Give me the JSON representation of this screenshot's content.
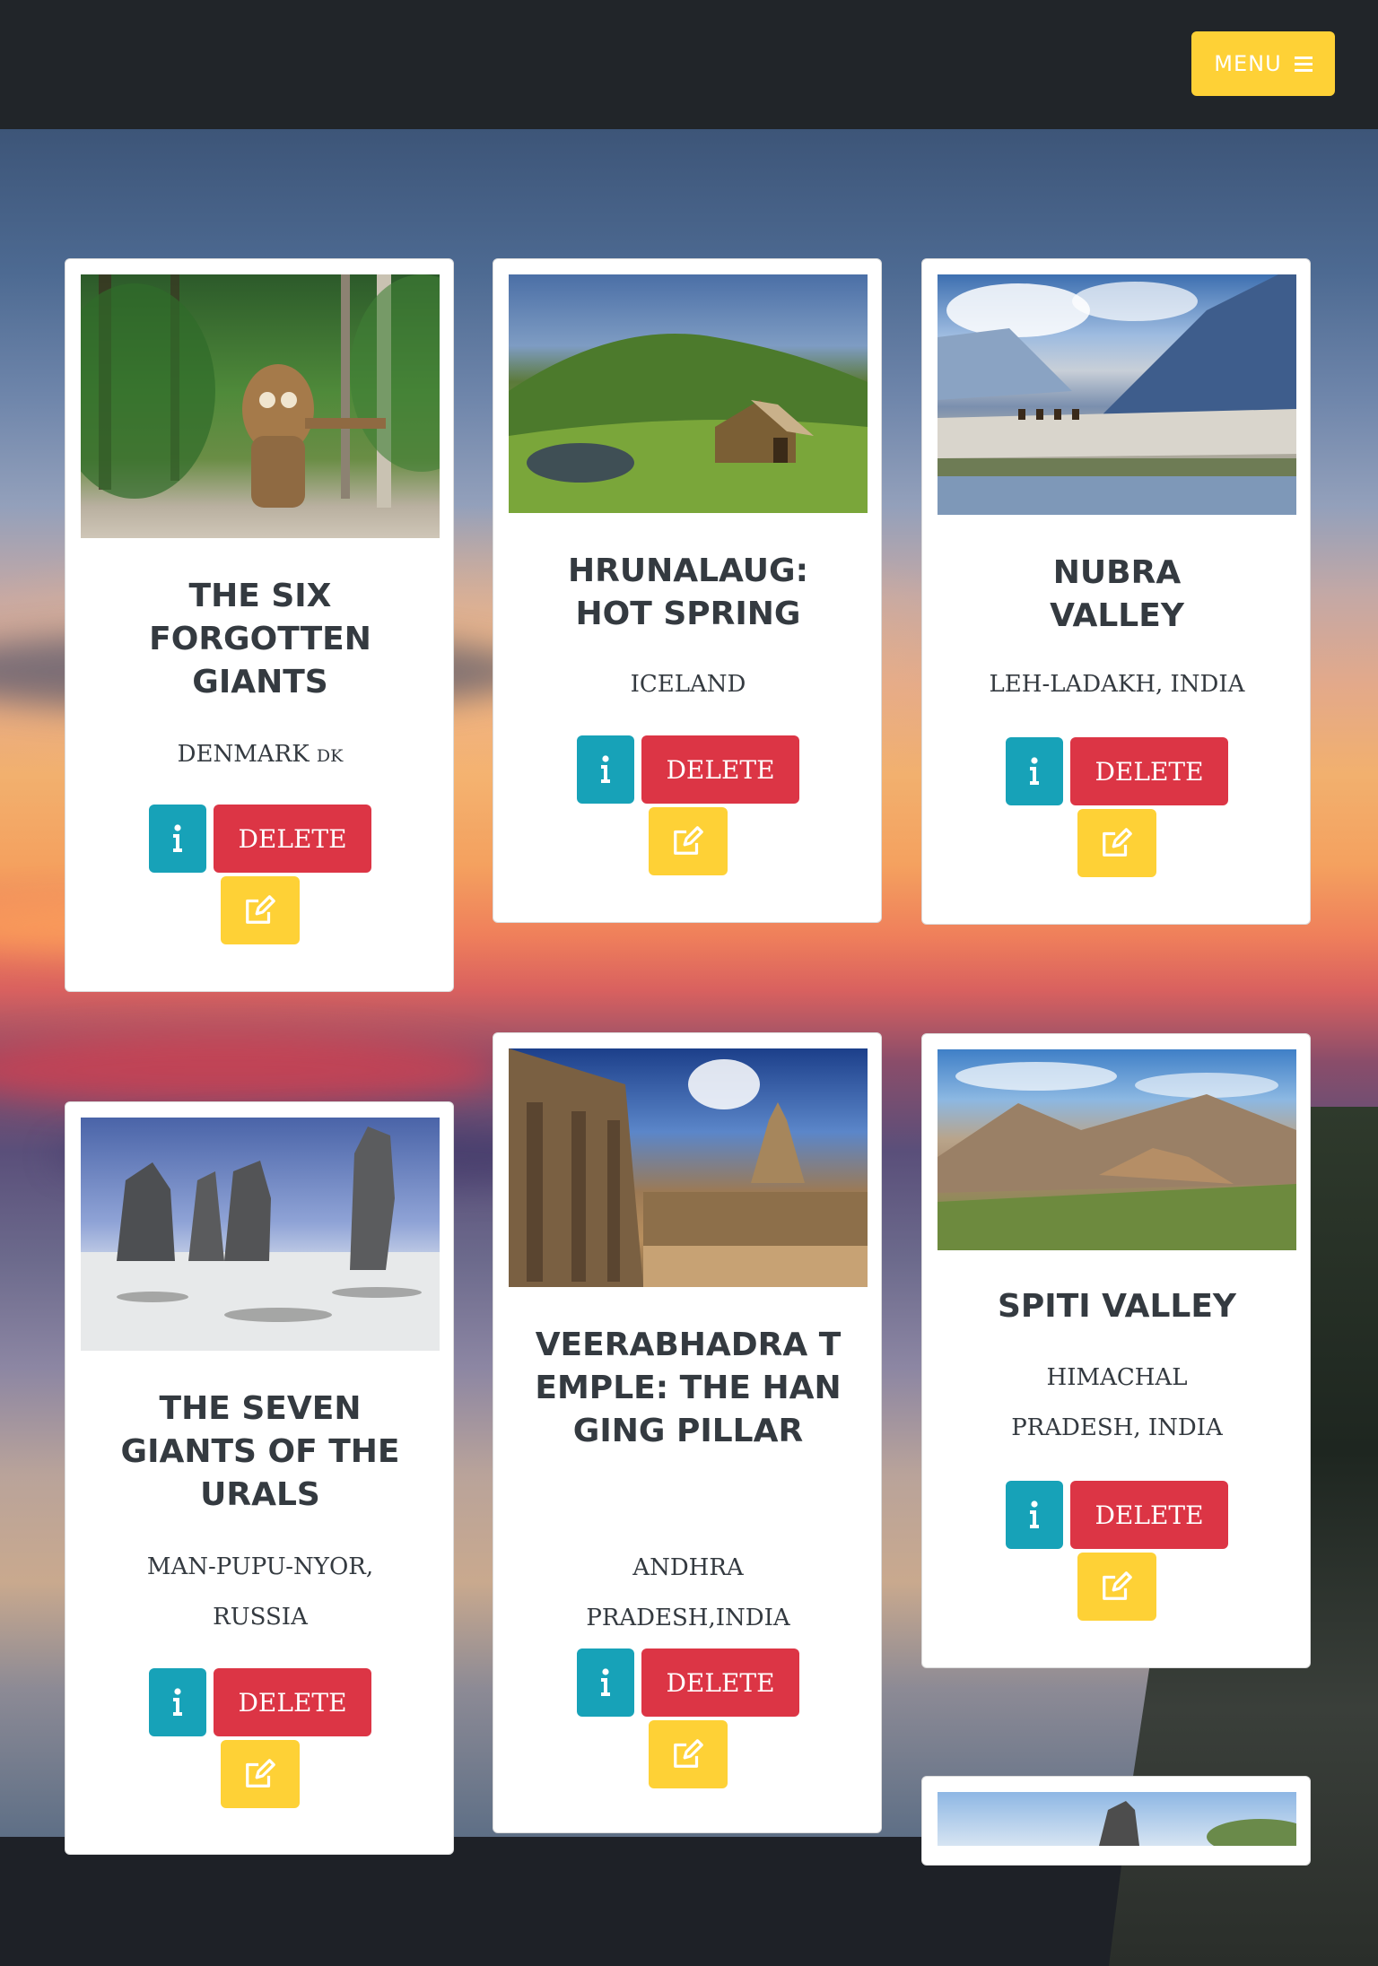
{
  "navbar": {
    "menu_label": "MENU"
  },
  "colors": {
    "accent": "#fed136",
    "info": "#17a2b8",
    "danger": "#dc3545",
    "dark": "#212529"
  },
  "cards": [
    {
      "title": "THE SIX FORGOTTEN GIANTS",
      "location": "DENMARK",
      "location_code": "DK",
      "delete_label": "DELETE"
    },
    {
      "title": "HRUNALAUG: HOT SPRING",
      "location": "ICELAND",
      "delete_label": "DELETE"
    },
    {
      "title": "NUBRA VALLEY",
      "location": "LEH-LADAKH, INDIA",
      "delete_label": "DELETE"
    },
    {
      "title": "THE SEVEN GIANTS OF THE URALS",
      "location": "MAN-PUPU-NYOR, RUSSIA",
      "delete_label": "DELETE"
    },
    {
      "title": "VEERABHADRA TEMPLE: THE HANGING PILLAR",
      "location": "ANDHRA PRADESH,INDIA",
      "delete_label": "DELETE"
    },
    {
      "title": "SPITI VALLEY",
      "location": "HIMACHAL PRADESH, INDIA",
      "delete_label": "DELETE"
    }
  ],
  "icons": {
    "info": "info-icon",
    "edit": "edit-icon",
    "menu": "hamburger-icon"
  }
}
